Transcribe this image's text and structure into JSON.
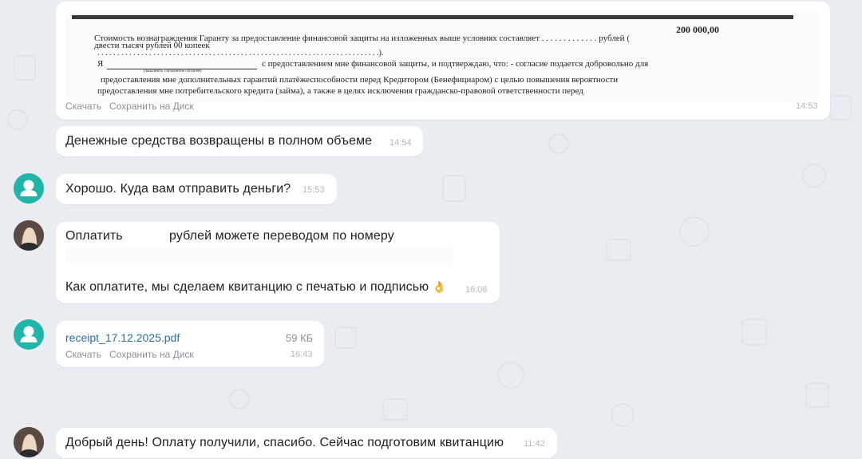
{
  "messages": {
    "doc_msg": {
      "doc_lines": {
        "amount": "200 000,00",
        "line1": "Стоимость вознаграждения Гаранту за предоставление финансовой защиты на изложенных выше условиях составляет . . . . . . . . . . . . . рублей (",
        "line1b": "двести тысяч рублей 00 копеек",
        "line2": ". . . . . . . . . . . . . . . . . . . . . . . . . . . . . . . . . . . . . . . . . . . . . . . . . . . . . . . . . . . . . . . . . . . . . . .).",
        "line3a": "Я",
        "line3b": "с предоставлением мне финансовой защиты, и подтверждаю, что: - согласие подается добровольно для",
        "line3c": "(Заполнить: согласен/не согласен)",
        "line4": "предоставления мне дополнительных гарантий платёжеспособности перед Кредитором (Бенефициаром) с целью повышения вероятности",
        "line5": "предоставления мне потребительского кредита (займа), а также в целях исключения гражданско-правовой ответственности перед"
      },
      "download": "Скачать",
      "save_to_disk": "Сохранить на Диск",
      "time": "14:53"
    },
    "msg1": {
      "text": "Денежные средства возвращены в полном объеме",
      "time": "14:54"
    },
    "msg2": {
      "text": "Хорошо. Куда вам отправить деньги?",
      "time": "15:53"
    },
    "msg3": {
      "line1a": "Оплатить",
      "line1b": "рублей можете переводом по номеру",
      "line2": "Как оплатите, мы сделаем квитанцию с печатью и подписью",
      "emoji": "👌",
      "time": "16:06"
    },
    "msg4": {
      "file_name": "receipt_17.12.2025.pdf",
      "file_size": "59 КБ",
      "download": "Скачать",
      "save_to_disk": "Сохранить на Диск",
      "time": "16:43"
    },
    "msg5": {
      "text": "Добрый день! Оплату получили, спасибо. Сейчас подготовим квитанцию",
      "time": "11:42"
    }
  },
  "colors": {
    "background": "#e9edf1",
    "bubble": "#ffffff",
    "link": "#2a6fa8",
    "avatar_generic": "#1fb5a8"
  },
  "icons": {
    "generic_avatar": "user-silhouette-icon",
    "emoji": "ok-hand-emoji"
  }
}
